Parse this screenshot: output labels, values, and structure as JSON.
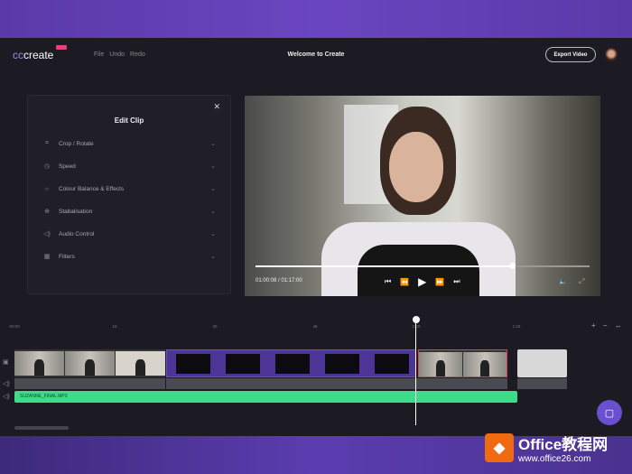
{
  "header": {
    "logo_prefix": "cc",
    "logo_main": "create",
    "menu": [
      "File",
      "Undo",
      "Redo"
    ],
    "title": "Welcome to Create",
    "export_label": "Export Video"
  },
  "edit_clip": {
    "title": "Edit Clip",
    "close": "✕",
    "items": [
      {
        "label": "Crop / Rotate",
        "icon": "⌗"
      },
      {
        "label": "Speed",
        "icon": "◷"
      },
      {
        "label": "Colour Balance & Effects",
        "icon": "☼"
      },
      {
        "label": "Stabalisation",
        "icon": "⊕"
      },
      {
        "label": "Audio Control",
        "icon": "◁)"
      },
      {
        "label": "Filters",
        "icon": "▦"
      }
    ],
    "chevron": "⌄"
  },
  "player": {
    "time": "01:00:08 / 01:17:00",
    "progress": 0.77,
    "controls": {
      "start": "⏮",
      "rew": "⏪",
      "play": "▶",
      "ff": "⏩",
      "end": "⏭"
    },
    "volume": "🔈",
    "fullscreen": "⤢"
  },
  "timeline": {
    "ticks": [
      "00:00",
      "15",
      "30",
      "45",
      "1:00",
      "1:15"
    ],
    "zoom_controls": "+ − ↔",
    "music_label": "SUZANNE_FINAL.MP3",
    "playhead_position": 0.8
  },
  "watermark": {
    "logo": "◆",
    "title": "Office教程网",
    "url": "www.office26.com"
  }
}
